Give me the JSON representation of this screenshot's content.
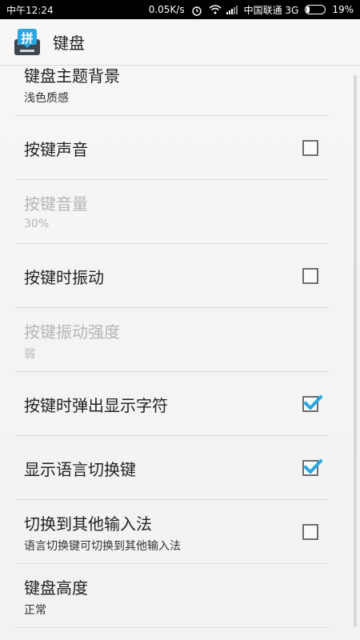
{
  "status_bar": {
    "time": "中午12:24",
    "network_speed": "0.05K/s",
    "carrier": "中国联通 3G",
    "battery": "19%",
    "battery_level": 0.19
  },
  "app": {
    "title": "键盘",
    "icon_glyph": "拼",
    "accent_color": "#2aa7e2"
  },
  "settings": {
    "items": [
      {
        "title": "键盘主题背景",
        "summary": "浅色质感"
      },
      {
        "title": "按键声音",
        "checked": false
      },
      {
        "title": "按键音量",
        "summary": "30%",
        "enabled": false
      },
      {
        "title": "按键时振动",
        "checked": false
      },
      {
        "title": "按键振动强度",
        "summary": "弱",
        "enabled": false
      },
      {
        "title": "按键时弹出显示字符",
        "checked": true
      },
      {
        "title": "显示语言切换键",
        "checked": true
      },
      {
        "title": "切换到其他输入法",
        "summary": "语言切换键可切换到其他输入法",
        "checked": false
      },
      {
        "title": "键盘高度",
        "summary": "正常"
      }
    ]
  }
}
